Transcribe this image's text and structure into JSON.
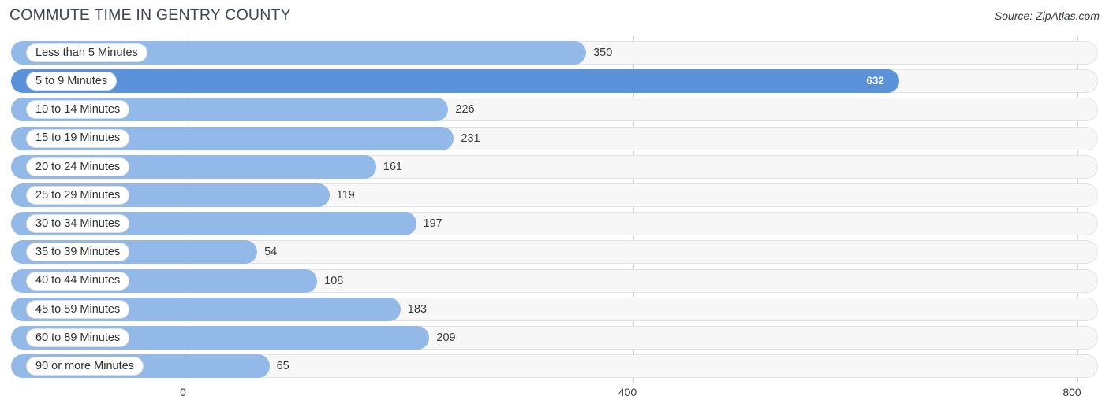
{
  "header": {
    "title": "COMMUTE TIME IN GENTRY COUNTY",
    "source": "Source: ZipAtlas.com"
  },
  "chart_data": {
    "type": "bar",
    "orientation": "horizontal",
    "title": "COMMUTE TIME IN GENTRY COUNTY",
    "xlabel": "",
    "ylabel": "",
    "xlim": [
      0,
      800
    ],
    "xticks": [
      0,
      400,
      800
    ],
    "xtick_labels": [
      "0",
      "400",
      "800"
    ],
    "grid": true,
    "legend": false,
    "highlight_color": "#5b93db",
    "bar_color": "#92b9e8",
    "track_color": "#f7f7f7",
    "categories": [
      "Less than 5 Minutes",
      "5 to 9 Minutes",
      "10 to 14 Minutes",
      "15 to 19 Minutes",
      "20 to 24 Minutes",
      "25 to 29 Minutes",
      "30 to 34 Minutes",
      "35 to 39 Minutes",
      "40 to 44 Minutes",
      "45 to 59 Minutes",
      "60 to 89 Minutes",
      "90 or more Minutes"
    ],
    "values": [
      350,
      632,
      226,
      231,
      161,
      119,
      197,
      54,
      108,
      183,
      209,
      65
    ],
    "value_labels": [
      "350",
      "632",
      "226",
      "231",
      "161",
      "119",
      "197",
      "54",
      "108",
      "183",
      "209",
      "65"
    ],
    "highlighted_index": 1
  }
}
